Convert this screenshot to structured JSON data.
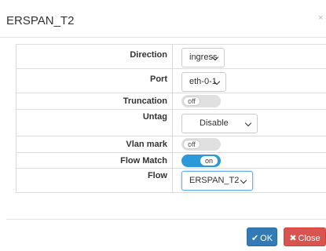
{
  "dialog": {
    "title": "ERSPAN_T2",
    "close_glyph": "×"
  },
  "form": {
    "direction": {
      "label": "Direction",
      "value": "ingress"
    },
    "port": {
      "label": "Port",
      "value": "eth-0-1"
    },
    "truncation": {
      "label": "Truncation",
      "state": "off"
    },
    "untag": {
      "label": "Untag",
      "value": "Disable"
    },
    "vlan_mark": {
      "label": "Vlan mark",
      "state": "off"
    },
    "flow_match": {
      "label": "Flow Match",
      "state": "on"
    },
    "flow": {
      "label": "Flow",
      "value": "ERSPAN_T2"
    }
  },
  "buttons": {
    "ok": {
      "label": "OK",
      "icon": "check-icon"
    },
    "close": {
      "label": "Close",
      "icon": "x-icon"
    }
  },
  "colors": {
    "primary": "#337ab7",
    "danger": "#d9534f",
    "toggle_on": "#2c9ad8"
  }
}
